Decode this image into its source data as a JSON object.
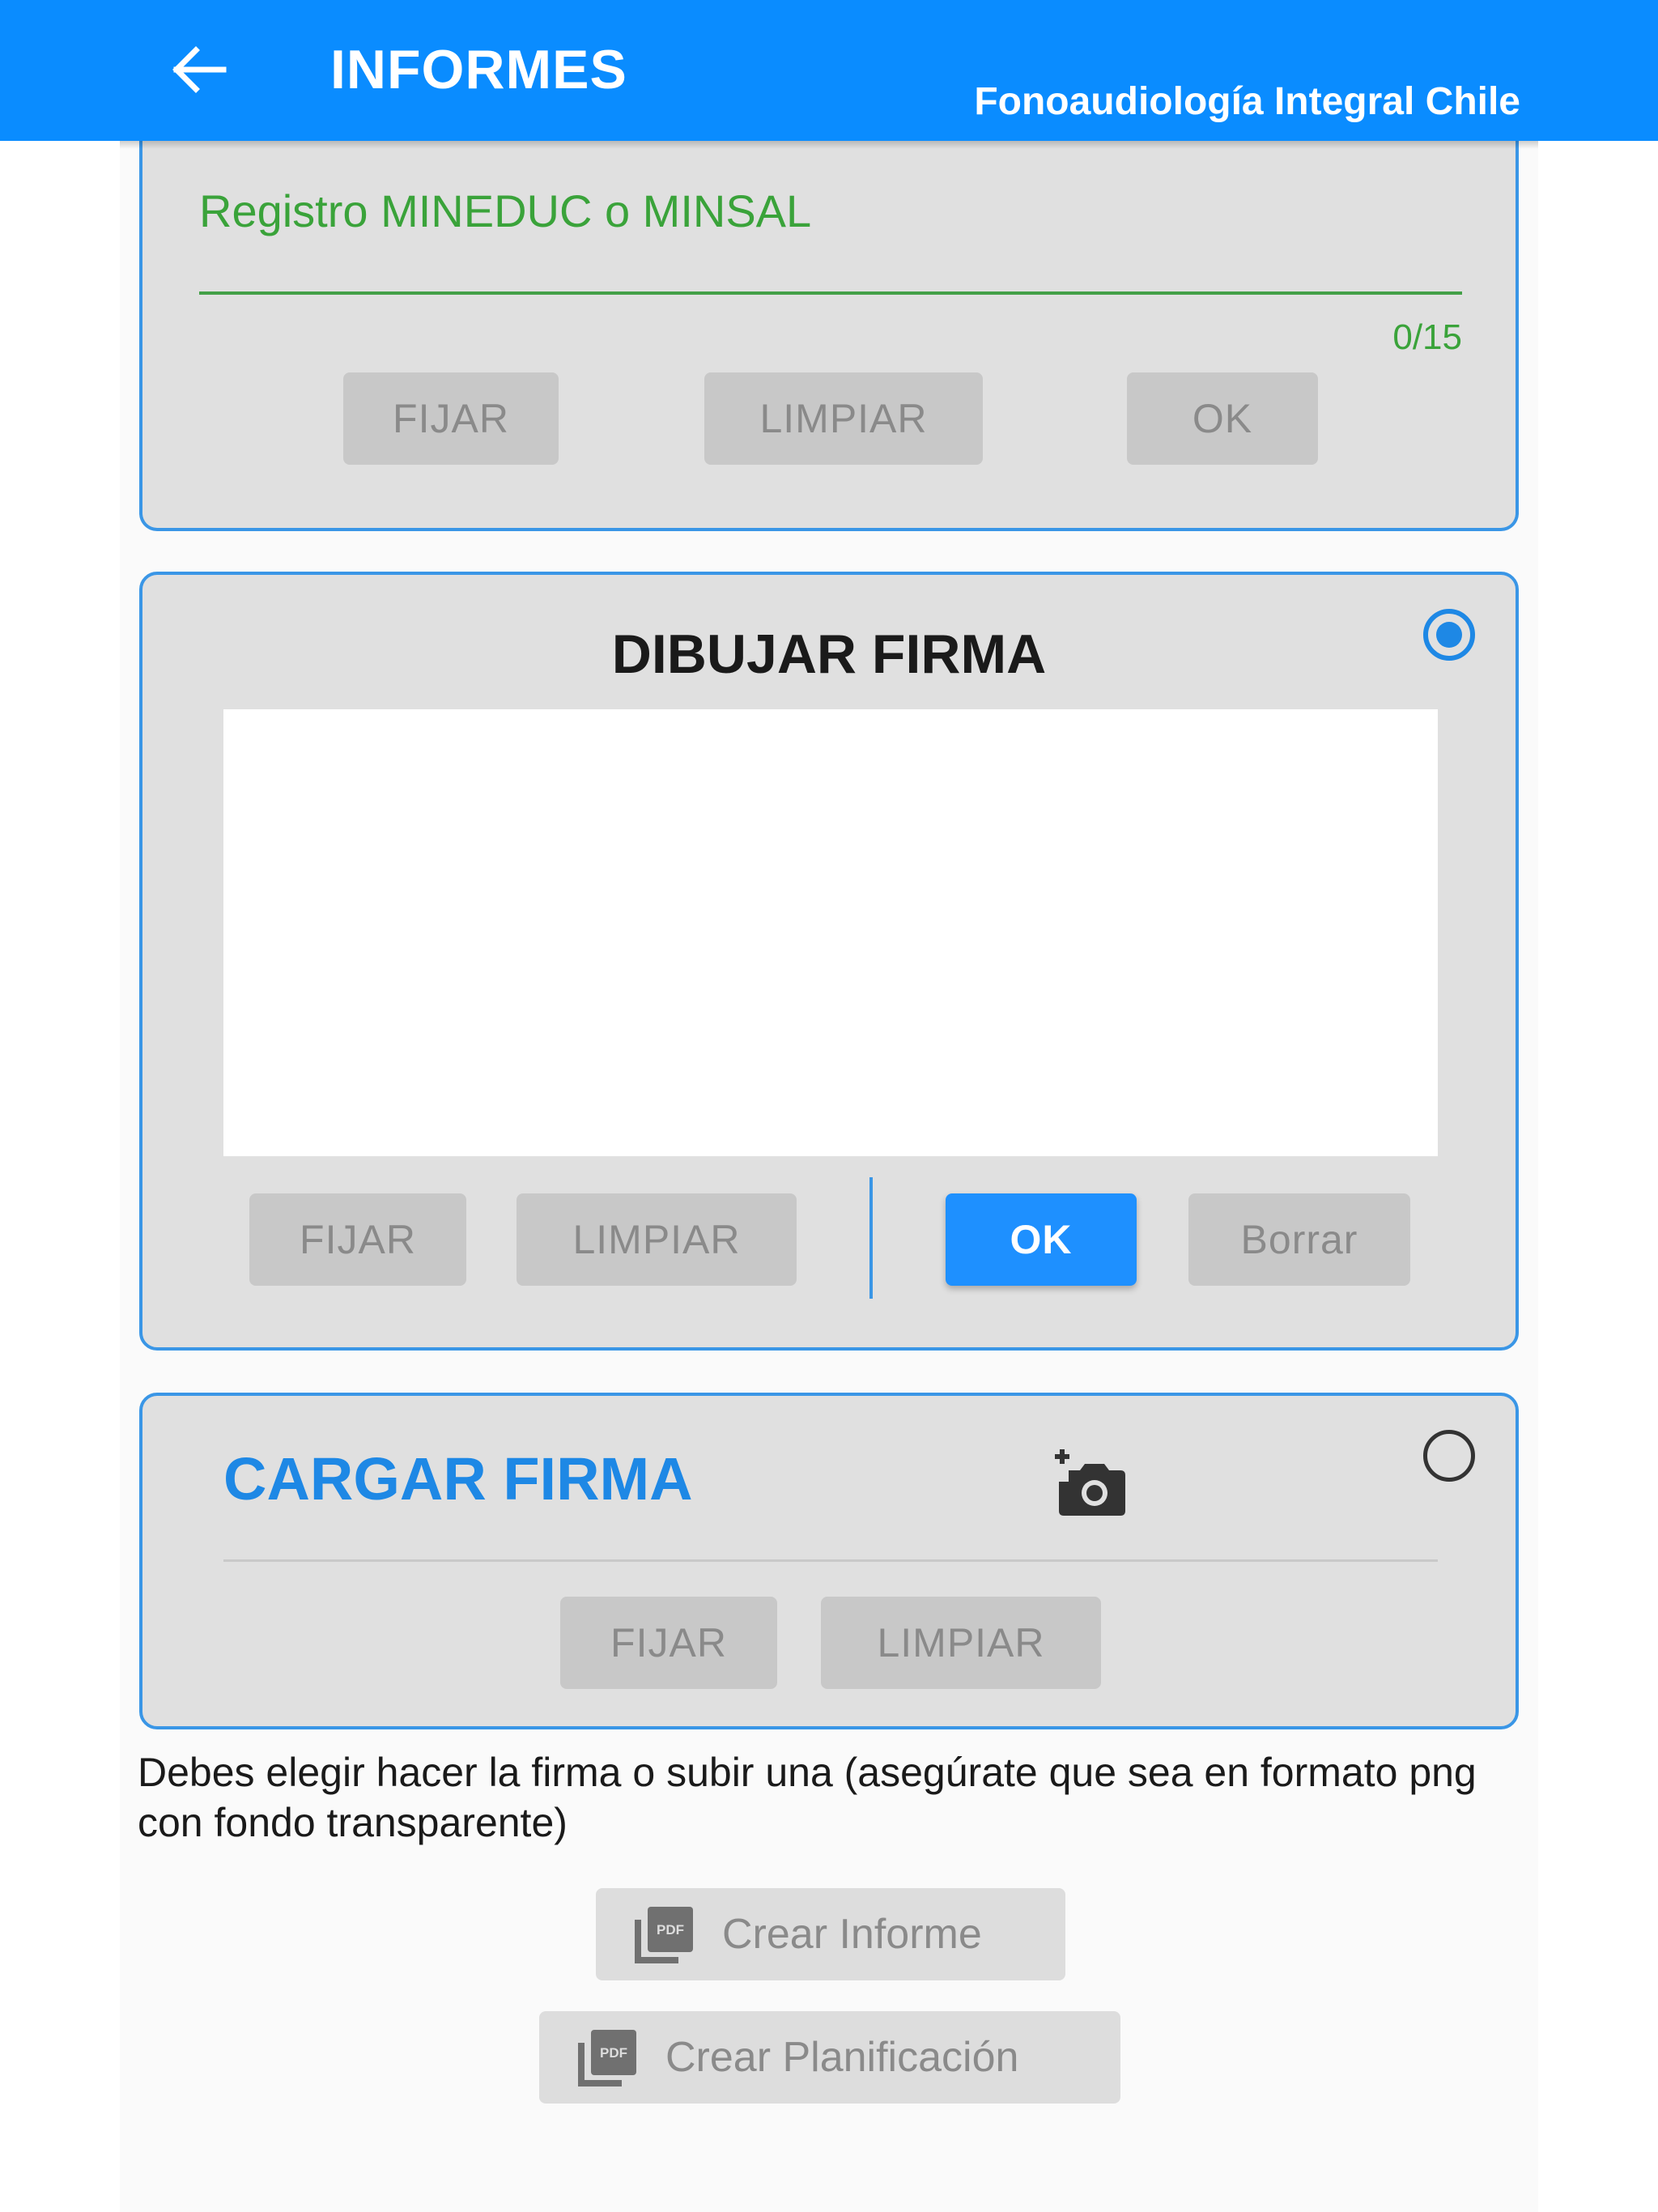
{
  "app_bar": {
    "back_icon": "arrow-left-icon",
    "title": "INFORMES",
    "subtitle": "Fonoaudiología Integral Chile",
    "background": "#0a8cff"
  },
  "registro_section": {
    "field_label": "Registro MINEDUC o MINSAL",
    "counter": "0/15",
    "buttons": {
      "fijar": "FIJAR",
      "limpiar": "LIMPIAR",
      "ok": "OK"
    }
  },
  "dibujar_section": {
    "title": "DIBUJAR FIRMA",
    "selected": true,
    "buttons": {
      "fijar": "FIJAR",
      "limpiar": "LIMPIAR",
      "ok": "OK",
      "borrar": "Borrar"
    }
  },
  "cargar_section": {
    "title": "CARGAR FIRMA",
    "selected": false,
    "camera_icon": "add-photo-camera-icon",
    "buttons": {
      "fijar": "FIJAR",
      "limpiar": "LIMPIAR"
    }
  },
  "instructions": "Debes elegir hacer la firma o subir una (asegúrate que sea en formato png con fondo transparente)",
  "actions": {
    "crear_informe": "Crear Informe",
    "crear_planificacion": "Crear Planificación",
    "pdf_icon": "pdf-icon"
  },
  "colors": {
    "accent": "#1e88e5",
    "ok_button": "#1e90ff",
    "field_green": "#3aa33a",
    "card_bg": "#e0e0e0"
  }
}
